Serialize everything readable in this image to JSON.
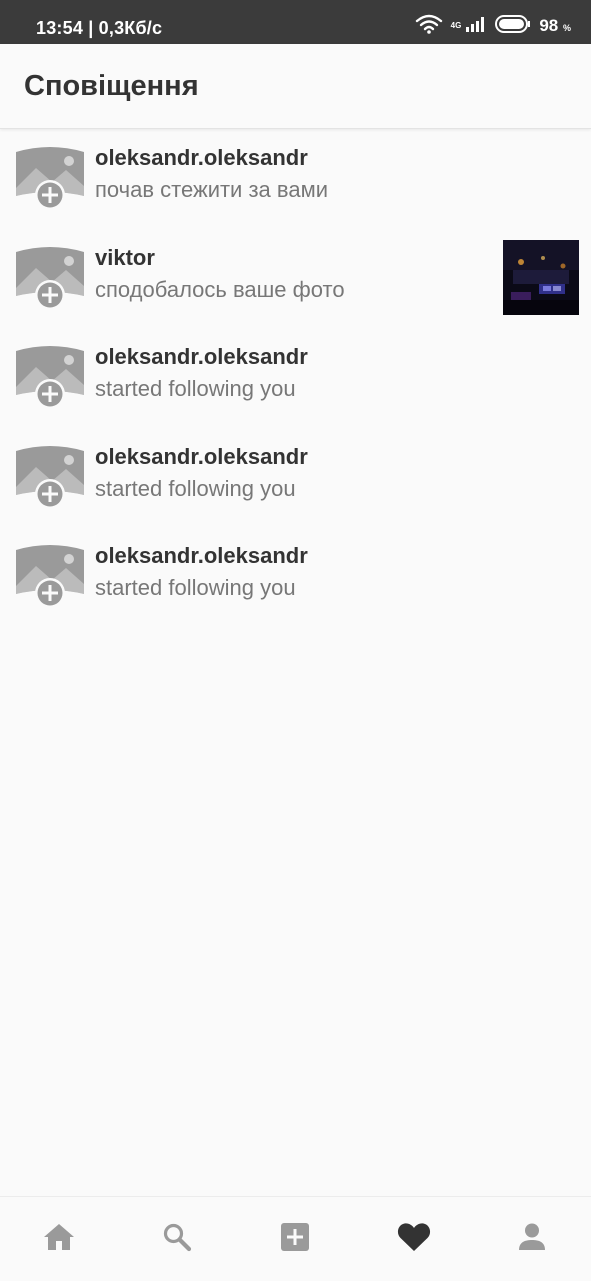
{
  "status_bar": {
    "time_and_speed": "13:54 | 0,3Кб/с",
    "network_type": "4G",
    "battery_percent": "98",
    "battery_unit": "%"
  },
  "header": {
    "title": "Сповіщення"
  },
  "notifications": [
    {
      "username": "oleksandr.oleksandr",
      "action": "почав стежити за вами"
    },
    {
      "username": "viktor",
      "action": "сподобалось ваше фото"
    },
    {
      "username": "oleksandr.oleksandr",
      "action": "started following you"
    },
    {
      "username": "oleksandr.oleksandr",
      "action": "started following you"
    },
    {
      "username": "oleksandr.oleksandr",
      "action": "started following you"
    }
  ],
  "bottom_nav": {
    "items": [
      "home-icon",
      "search-icon",
      "add-post-icon",
      "heart-icon",
      "profile-icon"
    ],
    "active": "heart-icon"
  },
  "colors": {
    "status_bar_bg": "#3b3b3b",
    "icon_gray": "#9a9a9a",
    "active_icon": "#333333"
  }
}
